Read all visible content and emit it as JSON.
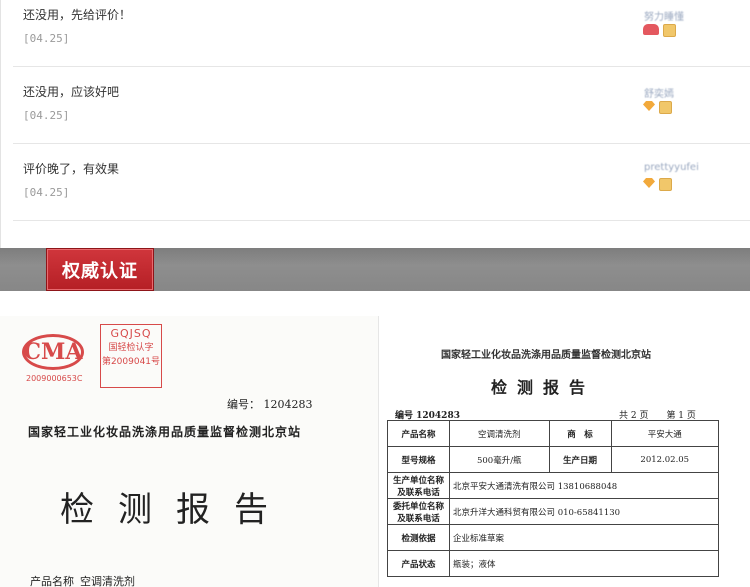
{
  "reviews": [
    {
      "text": "还没用，先给评价！",
      "date": "[04.25]",
      "user": "努力睡懂"
    },
    {
      "text": "还没用，应该好吧",
      "date": "[04.25]",
      "user": "舒奕嫣"
    },
    {
      "text": "评价晚了，有效果",
      "date": "[04.25]",
      "user": "prettyyufei"
    }
  ],
  "section": {
    "title": "权威认证"
  },
  "report_left": {
    "ma_text": "CMA",
    "ma_number": "2009000653C",
    "stamp_line1": "GQJSQ",
    "stamp_line2": "国轻检认字",
    "stamp_line3": "第2009041号",
    "doc_label": "编号：",
    "doc_number": "1204283",
    "institution": "国家轻工业化妆品洗涤用品质量监督检测北京站",
    "title": "检测报告",
    "product_label": "产品名称",
    "product_value": "空调清洗剂"
  },
  "report_right": {
    "institution": "国家轻工业化妆品洗涤用品质量监督检测北京站",
    "title": "检测报告",
    "number": "编号 1204283",
    "page": "共 2 页　　第 1 页",
    "rows": [
      {
        "k1": "产品名称",
        "v1": "空调清洗剂",
        "k2": "商　标",
        "v2": "平安大通"
      },
      {
        "k1": "型号规格",
        "v1": "500毫升/瓶",
        "k2": "生产日期",
        "v2": "2012.02.05"
      },
      {
        "k1": "生产单位名称及联系电话",
        "v1": "北京平安大通清洗有限公司 13810688048"
      },
      {
        "k1": "委托单位名称及联系电话",
        "v1": "北京升洋大通科贸有限公司 010-65841130"
      },
      {
        "k1": "检测依据",
        "v1": "企业标准草案"
      },
      {
        "k1": "产品状态",
        "v1": "瓶装；液体"
      }
    ]
  }
}
